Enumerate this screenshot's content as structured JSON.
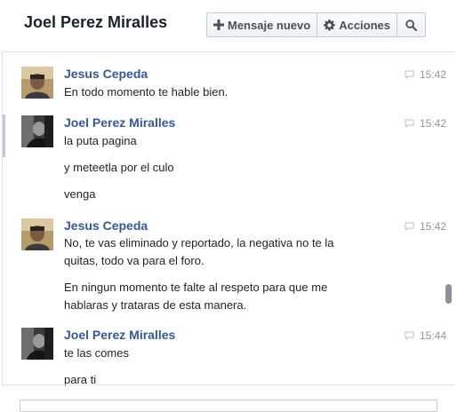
{
  "header": {
    "title": "Joel Perez Miralles",
    "new_message_label": "Mensaje nuevo",
    "actions_label": "Acciones"
  },
  "colors": {
    "name_link": "#365899",
    "text": "#1d2129",
    "meta": "#90949c"
  },
  "messages": [
    {
      "sender": "Jesus Cepeda",
      "time": "15:42",
      "lines": [
        "En todo momento te hable bien."
      ]
    },
    {
      "sender": "Joel Perez Miralles",
      "time": "15:42",
      "lines": [
        "la puta pagina",
        "y meteetla por el culo",
        "venga"
      ]
    },
    {
      "sender": "Jesus Cepeda",
      "time": "15:42",
      "lines": [
        "No, te vas eliminado y reportado, la negativa no te la quitas, todo va para el foro.",
        "En ningun momento te falte al respeto para que me hablaras y trataras de esta manera."
      ]
    },
    {
      "sender": "Joel Perez Miralles",
      "time": "15:44",
      "lines": [
        "te las comes",
        "para ti"
      ]
    }
  ]
}
